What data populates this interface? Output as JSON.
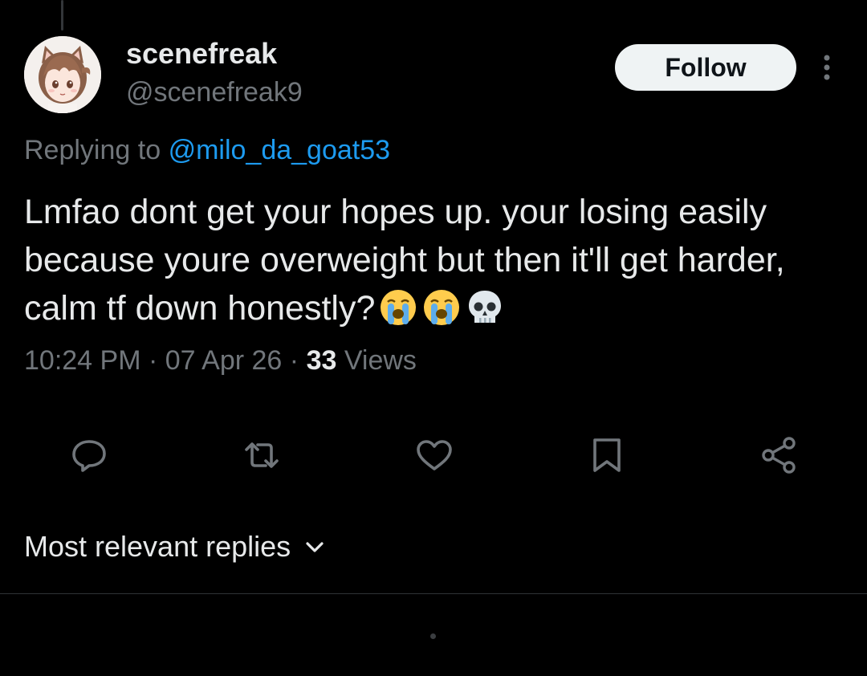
{
  "tweet": {
    "author": {
      "name": "scenefreak",
      "handle": "@scenefreak9"
    },
    "follow_label": "Follow",
    "replying_prefix": "Replying to",
    "replying_to": "@milo_da_goat53",
    "text": "Lmfao dont get your hopes up. your losing easily because youre overweight but then it'll get harder, calm tf down honestly?",
    "emojis": [
      "loudly-crying-face",
      "loudly-crying-face",
      "skull"
    ],
    "time": "10:24 PM",
    "separator": "·",
    "date": "07 Apr 26",
    "views_count": "33",
    "views_label": "Views"
  },
  "actions": [
    "reply-icon",
    "retweet-icon",
    "like-icon",
    "bookmark-icon",
    "share-icon"
  ],
  "replies_sort": {
    "label": "Most relevant replies"
  },
  "colors": {
    "background": "#000000",
    "text_primary": "#e7e9ea",
    "text_secondary": "#71767b",
    "accent": "#1d9bf0",
    "follow_button_bg": "#eff3f4"
  }
}
